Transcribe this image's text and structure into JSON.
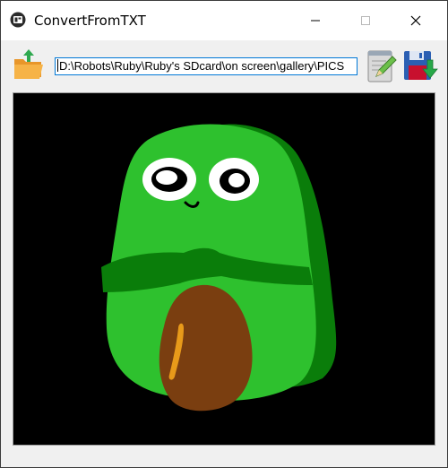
{
  "window": {
    "title": "ConvertFromTXT",
    "icon": "app-icon"
  },
  "controls": {
    "minimize_icon": "minimize-icon",
    "maximize_icon": "maximize-icon",
    "close_icon": "close-icon"
  },
  "toolbar": {
    "open_icon": "open-folder-icon",
    "path_value": "D:\\Robots\\Ruby\\Ruby's SDcard\\on screen\\gallery\\PICS",
    "edit_icon": "edit-notepad-icon",
    "save_icon": "save-disk-icon"
  },
  "image": {
    "description_icon": "picture-preview",
    "colors": {
      "background": "#000000",
      "body_light": "#2ec12e",
      "body_dark": "#0a7d0a",
      "seed": "#7a3e10",
      "seed_highlight": "#e89a1a",
      "eye_white": "#ffffff"
    }
  }
}
